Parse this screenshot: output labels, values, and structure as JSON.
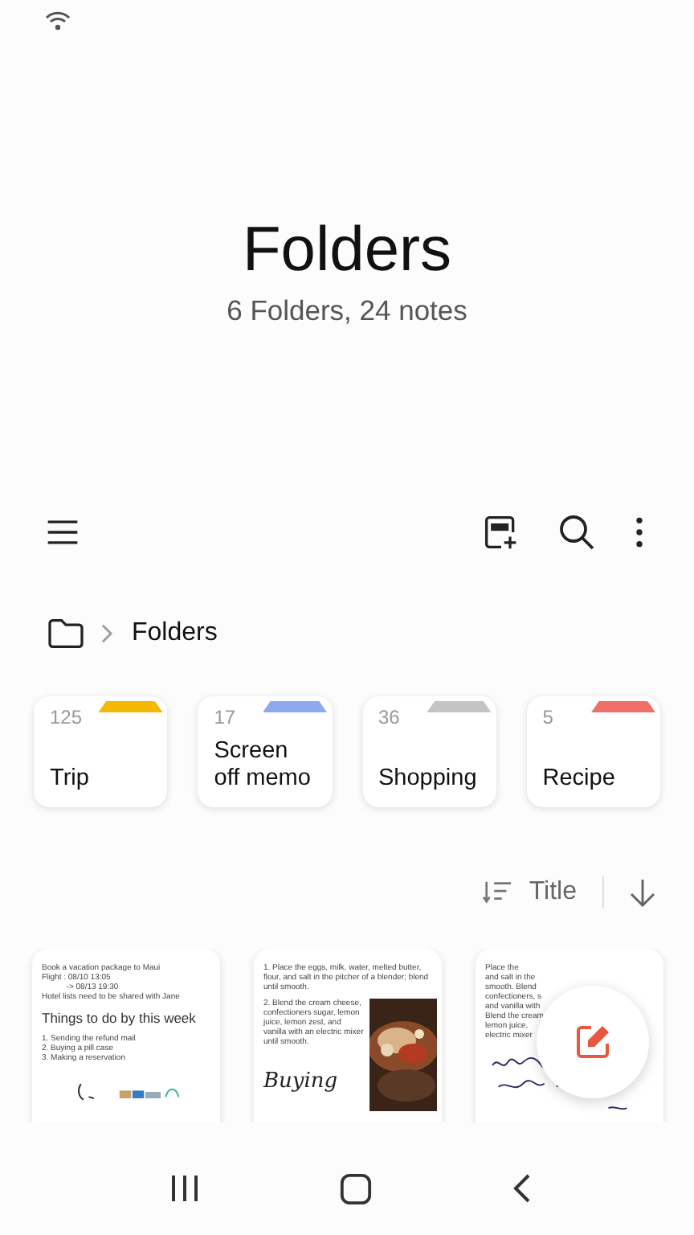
{
  "header": {
    "title": "Folders",
    "subtitle": "6 Folders, 24 notes"
  },
  "breadcrumb": {
    "label": "Folders"
  },
  "folders": [
    {
      "count": "125",
      "name": "Trip",
      "color": "#f5b800"
    },
    {
      "count": "17",
      "name": "Screen off memo",
      "color": "#8fa9f0"
    },
    {
      "count": "36",
      "name": "Shopping",
      "color": "#c4c4c4"
    },
    {
      "count": "5",
      "name": "Recipe",
      "color": "#f07068"
    }
  ],
  "sort": {
    "label": "Title"
  },
  "notes": [
    {
      "kind": "todo",
      "blocks": [
        {
          "heading": false,
          "lines": [
            "Book a vacation package to Maui",
            "Flight : 08/10 13:05",
            "           -> 08/13 19:30",
            "Hotel lists need to be shared with Jane"
          ]
        },
        {
          "heading": true,
          "lines": [
            "Things to do by this week"
          ]
        },
        {
          "heading": false,
          "lines": [
            "1. Sending the refund mail",
            "2. Buying a pill case",
            "3. Making a reservation"
          ]
        }
      ]
    },
    {
      "kind": "recipe",
      "blocks": [
        {
          "heading": false,
          "lines": [
            "1. Place the eggs, milk, water, melted butter,",
            "flour, and salt in the pitcher of a blender; blend",
            "until smooth."
          ]
        },
        {
          "heading": false,
          "lines": [
            "2. Blend the cream cheese,",
            "confectioners sugar, lemon",
            "juice, lemon zest, and",
            "vanilla with an electric mixer",
            "until smooth."
          ]
        }
      ],
      "signature": "Buying"
    },
    {
      "kind": "handwritten",
      "blocks": [
        {
          "heading": false,
          "lines": [
            "Place the",
            "and salt in the",
            "smooth. Blend",
            "confectioners, s",
            "and vanilla with",
            "Blend the cream",
            "lemon juice,",
            "electric mixer"
          ]
        }
      ]
    }
  ]
}
